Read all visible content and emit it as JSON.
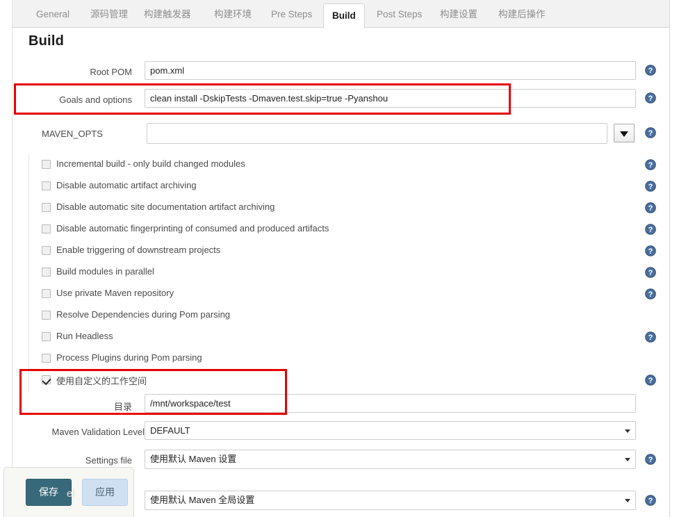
{
  "tabs": [
    {
      "label": "General",
      "active": false
    },
    {
      "label": "源码管理",
      "active": false
    },
    {
      "label": "构建触发器",
      "active": false
    },
    {
      "label": "构建环境",
      "active": false
    },
    {
      "label": "Pre Steps",
      "active": false
    },
    {
      "label": "Build",
      "active": true
    },
    {
      "label": "Post Steps",
      "active": false
    },
    {
      "label": "构建设置",
      "active": false
    },
    {
      "label": "构建后操作",
      "active": false
    }
  ],
  "section": {
    "title": "Build"
  },
  "fields": {
    "root_pom": {
      "label": "Root POM",
      "value": "pom.xml"
    },
    "goals_and_options": {
      "label": "Goals and options",
      "value": "clean install -DskipTests -Dmaven.test.skip=true -Pyanshou"
    },
    "maven_opts": {
      "label": "MAVEN_OPTS",
      "value": "",
      "dropdown_icon": "caret-down-icon"
    },
    "maven_validation_level": {
      "label": "Maven Validation Level",
      "value": "DEFAULT"
    },
    "settings_file": {
      "label": "Settings file",
      "value": "使用默认 Maven 设置"
    },
    "global_settings_file": {
      "label": "",
      "value": "使用默认 Maven 全局设置"
    },
    "custom_workspace": {
      "label": "使用自定义的工作空间",
      "checked": true
    },
    "custom_workspace_directory": {
      "label": "目录",
      "value": "/mnt/workspace/test"
    }
  },
  "checkboxes": [
    {
      "label": "Incremental build - only build changed modules",
      "checked": false,
      "help": true
    },
    {
      "label": "Disable automatic artifact archiving",
      "checked": false,
      "help": true
    },
    {
      "label": "Disable automatic site documentation artifact archiving",
      "checked": false,
      "help": true
    },
    {
      "label": "Disable automatic fingerprinting of consumed and produced artifacts",
      "checked": false,
      "help": true
    },
    {
      "label": "Enable triggering of downstream projects",
      "checked": false,
      "help": true
    },
    {
      "label": "Build modules in parallel",
      "checked": false,
      "help": true
    },
    {
      "label": "Use private Maven repository",
      "checked": false,
      "help": true
    },
    {
      "label": "Resolve Dependencies during Pom parsing",
      "checked": false,
      "help": false
    },
    {
      "label": "Run Headless",
      "checked": false,
      "help": true
    },
    {
      "label": "Process Plugins during Pom parsing",
      "checked": false,
      "help": false
    }
  ],
  "buttons": {
    "save": "保存",
    "apply": "应用"
  },
  "watermark": "el",
  "icons": {
    "help": "help-question-icon"
  },
  "colors": {
    "annotation": "#e60000",
    "save_button": "#38697a",
    "apply_button": "#cfe0f2",
    "help_icon": "#4a6f9e",
    "active_tab_text": "#1a1a1a",
    "inactive_tab_text": "#8e8e8e"
  }
}
